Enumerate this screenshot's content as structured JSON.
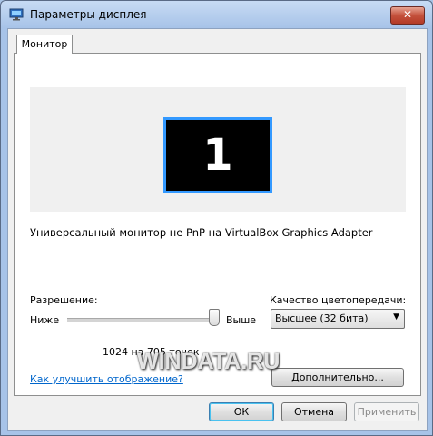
{
  "window": {
    "title": "Параметры дисплея",
    "close_glyph": "✕"
  },
  "tabs": [
    {
      "label": "Монитор",
      "active": true
    }
  ],
  "preview": {
    "monitor_number": "1",
    "accent": "#3399ff"
  },
  "monitor_description": "Универсальный монитор не PnP на VirtualBox Graphics Adapter",
  "resolution": {
    "label": "Разрешение:",
    "low_label": "Ниже",
    "high_label": "Выше",
    "slider_level": 1.0,
    "value_text": "1024 на 705 точек"
  },
  "color_quality": {
    "label": "Качество цветопередачи:",
    "selected": "Высшее (32 бита)",
    "arrow_icon": "▼"
  },
  "help_link": "Как улучшить отображение?",
  "buttons": {
    "advanced": "Дополнительно...",
    "ok": "ОК",
    "cancel": "Отмена",
    "apply": "Применить"
  },
  "watermark": "WINDATA.RU"
}
